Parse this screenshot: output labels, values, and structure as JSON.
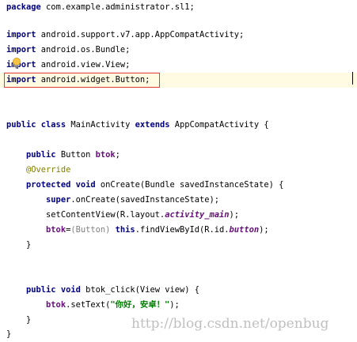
{
  "editor": {
    "lines": [
      [
        "package",
        " com.example.administrator.sl1;"
      ],
      [
        ""
      ],
      [
        "import",
        " android.support.v7.app.AppCompatActivity;"
      ],
      [
        "import",
        " android.os.Bundle;"
      ],
      [
        "import",
        " android.view.View;"
      ],
      [
        "import",
        " android.widget.Button;"
      ],
      [
        ""
      ],
      [
        ""
      ],
      [
        "public class",
        " MainActivity ",
        "extends",
        " AppCompatActivity {"
      ],
      [
        ""
      ],
      [
        "    ",
        "public",
        " Button ",
        "btok",
        ";"
      ],
      [
        "    ",
        "@Override"
      ],
      [
        "    ",
        "protected void",
        " onCreate(Bundle savedInstanceState) {"
      ],
      [
        "        ",
        "super",
        ".onCreate(savedInstanceState);"
      ],
      [
        "        setContentView(R.layout.",
        "activity_main",
        ");"
      ],
      [
        "        ",
        "btok",
        "=",
        "(Button)",
        " ",
        "this",
        ".findViewById(R.id.",
        "button",
        ");"
      ],
      [
        "    }"
      ],
      [
        ""
      ],
      [
        ""
      ],
      [
        "    ",
        "public void",
        " btok_click(View view) {"
      ],
      [
        "        ",
        "btok",
        ".setText(",
        "\"你好，安卓！\"",
        ");"
      ],
      [
        "    }"
      ],
      [
        "}"
      ]
    ]
  },
  "watermark": {
    "text": "http://blog.csdn.net/openbug"
  },
  "colors": {
    "keyword": "#000080",
    "annotation": "#808000",
    "field": "#660e7a",
    "string": "#008000",
    "highlight_box": "#e53935"
  }
}
